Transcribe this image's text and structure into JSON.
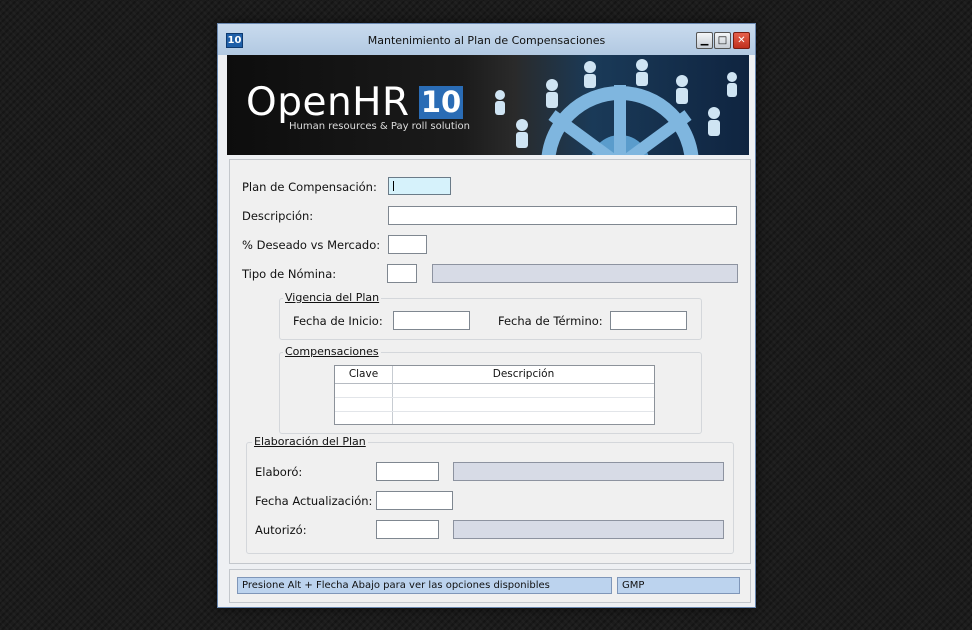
{
  "window": {
    "icon_label": "10",
    "title": "Mantenimiento al Plan de Compensaciones",
    "minimize": "▁",
    "maximize": "□",
    "close": "✕"
  },
  "banner": {
    "logo_text": "OpenHR",
    "logo_version": "10",
    "tagline": "Human resources & Pay roll solution"
  },
  "form": {
    "plan_label": "Plan de Compensación:",
    "plan_value": "",
    "descripcion_label": "Descripción:",
    "descripcion_value": "",
    "deseado_label": "% Deseado vs Mercado:",
    "deseado_value": "",
    "nomina_label": "Tipo de Nómina:",
    "nomina_code": "",
    "nomina_desc": ""
  },
  "vigencia": {
    "title": "Vigencia del Plan",
    "inicio_label": "Fecha de Inicio:",
    "inicio_value": "",
    "termino_label": "Fecha de Término:",
    "termino_value": ""
  },
  "compensaciones": {
    "title": "Compensaciones",
    "columns": [
      "Clave",
      "Descripción"
    ],
    "rows": []
  },
  "elaboracion": {
    "title": "Elaboración del Plan",
    "elaboro_label": "Elaboró:",
    "elaboro_code": "",
    "elaboro_name": "",
    "fecha_label": "Fecha Actualización:",
    "fecha_value": "",
    "autorizo_label": "Autorizó:",
    "autorizo_code": "",
    "autorizo_name": ""
  },
  "status": {
    "hint": "Presione Alt + Flecha Abajo para ver las opciones disponibles",
    "company": "GMP"
  },
  "colors": {
    "titlebar": "#b8cde5",
    "logo_accent": "#2a6cb5",
    "active_field": "#d6f2fb",
    "readonly_field": "#d7dbe6",
    "statusbar_cell": "#bcd3ee"
  }
}
